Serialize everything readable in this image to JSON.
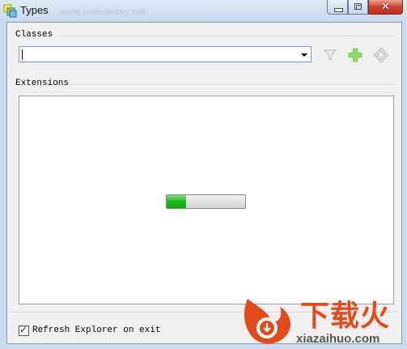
{
  "window": {
    "title": "Types",
    "title_overlay": "www.unitedeasy.net",
    "close_glyph": "✕"
  },
  "classes": {
    "label": "Classes",
    "combo_value": "",
    "toolbar_icons": [
      "filter-icon",
      "add-icon",
      "settings-icon"
    ]
  },
  "extensions": {
    "label": "Extensions",
    "progress_fraction": 0.25
  },
  "footer": {
    "checkbox_checked": true,
    "checkbox_mark": "✓",
    "checkbox_label": "Refresh Explorer on exit"
  },
  "watermark": {
    "text_cn": "下载火",
    "text_en": "xiazaihuo.com"
  },
  "colors": {
    "progress_fill": "#1fbb1f",
    "add_icon": "#6fcc4f",
    "watermark": "#e34b1b"
  }
}
